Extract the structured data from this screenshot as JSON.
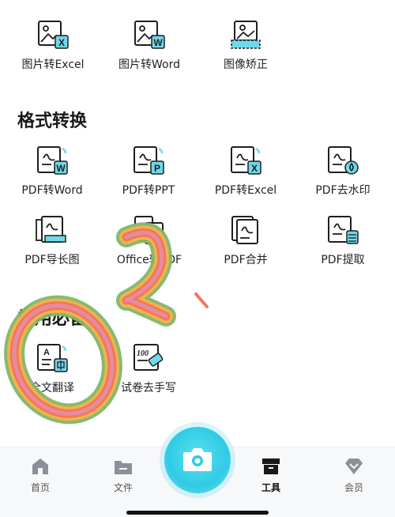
{
  "top_row": [
    {
      "label": "图片转Excel",
      "icon": "image-to-excel-icon",
      "badge": "X"
    },
    {
      "label": "图片转Word",
      "icon": "image-to-word-icon",
      "badge": "W"
    },
    {
      "label": "图像矫正",
      "icon": "image-correction-icon"
    }
  ],
  "format_section": {
    "title": "格式转换",
    "items": [
      {
        "label": "PDF转Word",
        "icon": "pdf-to-word-icon",
        "badge": "W"
      },
      {
        "label": "PDF转PPT",
        "icon": "pdf-to-ppt-icon",
        "badge": "P"
      },
      {
        "label": "PDF转Excel",
        "icon": "pdf-to-excel-icon",
        "badge": "X"
      },
      {
        "label": "PDF去水印",
        "icon": "pdf-remove-watermark-icon"
      },
      {
        "label": "PDF导长图",
        "icon": "pdf-to-long-image-icon"
      },
      {
        "label": "Office转PDF",
        "icon": "office-to-pdf-icon"
      },
      {
        "label": "PDF合并",
        "icon": "pdf-merge-icon"
      },
      {
        "label": "PDF提取",
        "icon": "pdf-extract-icon"
      }
    ]
  },
  "common_section": {
    "title": "常用必备",
    "items": [
      {
        "label": "全文翻译",
        "icon": "full-text-translate-icon"
      },
      {
        "label": "试卷去手写",
        "icon": "remove-handwriting-icon",
        "badge": "100"
      }
    ]
  },
  "bottom_nav": {
    "items": [
      {
        "label": "首页",
        "icon": "home-icon"
      },
      {
        "label": "文件",
        "icon": "folder-icon"
      },
      {
        "label": "工具",
        "icon": "toolbox-icon",
        "active": true
      },
      {
        "label": "会员",
        "icon": "vip-diamond-icon"
      }
    ],
    "camera_icon": "camera-icon"
  },
  "colors": {
    "accent": "#2fcbe6",
    "icon_stroke": "#1f1f1f",
    "badge_cyan": "#6fd9ea"
  }
}
